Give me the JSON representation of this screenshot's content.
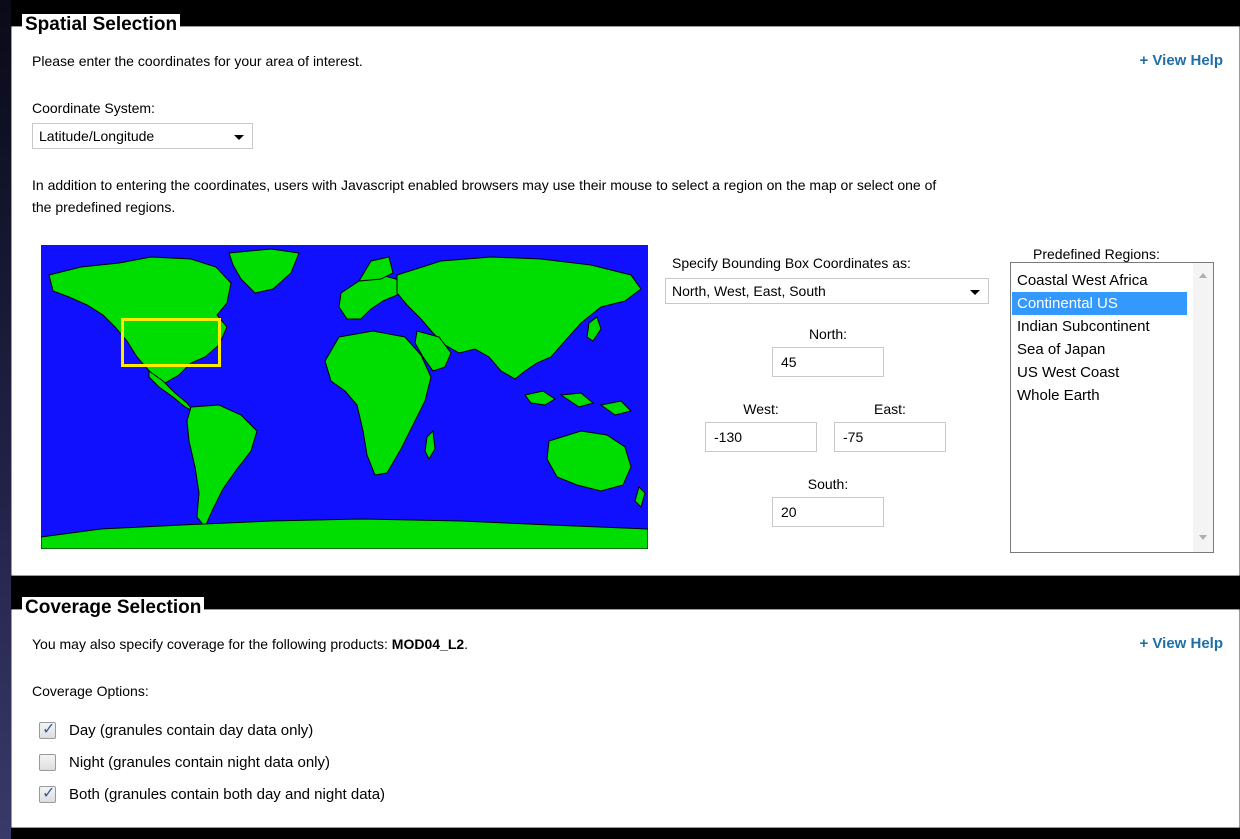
{
  "spatial": {
    "legend": "Spatial Selection",
    "intro": "Please enter the coordinates for your area of interest.",
    "help_link": "+ View Help",
    "coord_system_label": "Coordinate System:",
    "coord_system_value": "Latitude/Longitude",
    "description_line1": "In addition to entering the coordinates, users with Javascript enabled browsers may use their mouse to select a region on the map or select one of",
    "description_line2": "the predefined regions.",
    "bbox_label": "Specify Bounding Box Coordinates as:",
    "bbox_order": "North, West, East, South",
    "north_label": "North:",
    "north_value": "45",
    "west_label": "West:",
    "west_value": "-130",
    "east_label": "East:",
    "east_value": "-75",
    "south_label": "South:",
    "south_value": "20",
    "regions_label": "Predefined Regions:",
    "regions": [
      {
        "label": "Coastal West Africa",
        "selected": false
      },
      {
        "label": "Continental US",
        "selected": true
      },
      {
        "label": "Indian Subcontinent",
        "selected": false
      },
      {
        "label": "Sea of Japan",
        "selected": false
      },
      {
        "label": "US West Coast",
        "selected": false
      },
      {
        "label": "Whole Earth",
        "selected": false
      }
    ]
  },
  "coverage": {
    "legend": "Coverage Selection",
    "intro_prefix": "You may also specify coverage for the following products: ",
    "product": "MOD04_L2",
    "intro_suffix": ".",
    "help_link": "+ View Help",
    "options_label": "Coverage Options:",
    "options": [
      {
        "label": "Day (granules contain day data only)",
        "checked": true
      },
      {
        "label": "Night (granules contain night data only)",
        "checked": false
      },
      {
        "label": "Both (granules contain both day and night data)",
        "checked": true
      }
    ]
  },
  "colors": {
    "ocean": "#1010ff",
    "land": "#00dd00",
    "selection_box": "#ffeb00",
    "link": "#1f6ea8",
    "list_selected": "#3399ff"
  }
}
